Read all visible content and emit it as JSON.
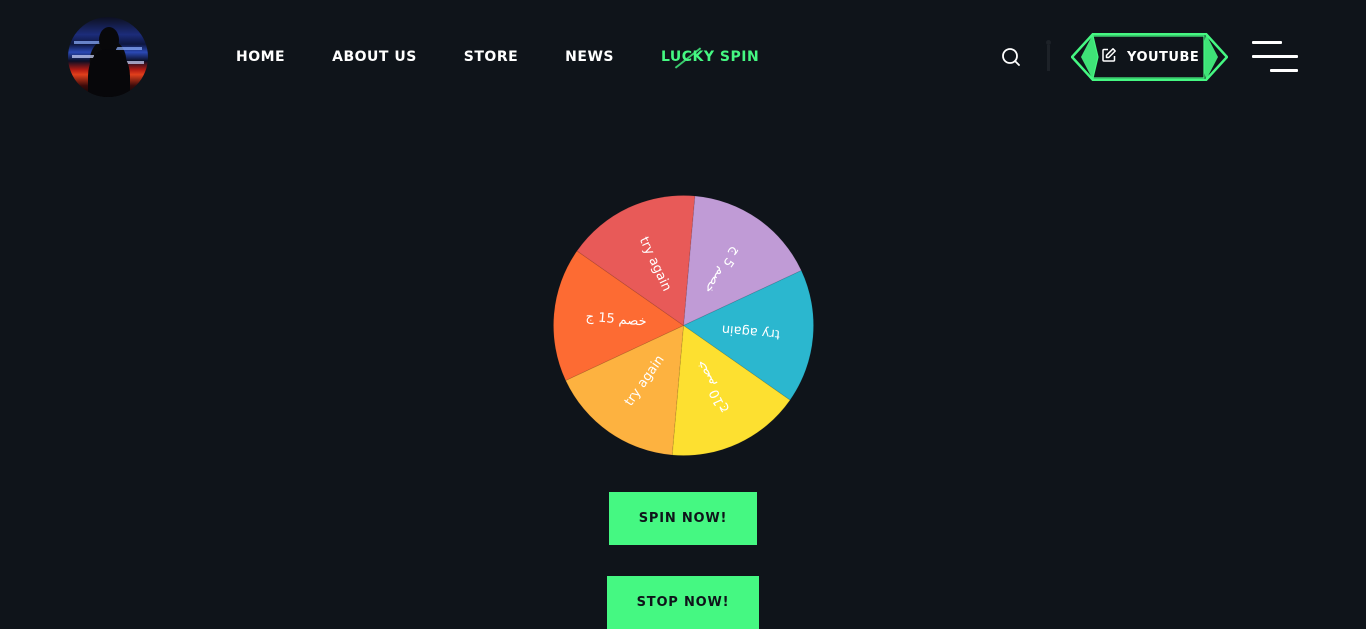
{
  "logo": {
    "alt_icon": "silhouette-logo"
  },
  "nav": {
    "items": [
      {
        "label": "HOME",
        "active": false
      },
      {
        "label": "ABOUT US",
        "active": false
      },
      {
        "label": "STORE",
        "active": false
      },
      {
        "label": "NEWS",
        "active": false
      },
      {
        "label": "LUCKY SPIN",
        "active": true
      }
    ]
  },
  "header": {
    "search_icon": "search-icon",
    "youtube_label": "YOUTUBE",
    "youtube_icon": "edit-icon",
    "menu_icon": "hamburger-menu-icon"
  },
  "colors": {
    "background": "#0f141a",
    "accent": "#45f882",
    "text": "#ffffff"
  },
  "wheel": {
    "segments": [
      {
        "label": "خصم 5 ج",
        "color": "#c09bd6"
      },
      {
        "label": "try again",
        "color": "#2bb7cf"
      },
      {
        "label": "خصم 10ج",
        "color": "#fde030"
      },
      {
        "label": "try again",
        "color": "#fdb240"
      },
      {
        "label": "خصم 15 ج",
        "color": "#fd6b33"
      },
      {
        "label": "try again",
        "color": "#e85a58"
      }
    ]
  },
  "actions": {
    "spin_label": "SPIN NOW!",
    "stop_label": "STOP NOW!"
  }
}
